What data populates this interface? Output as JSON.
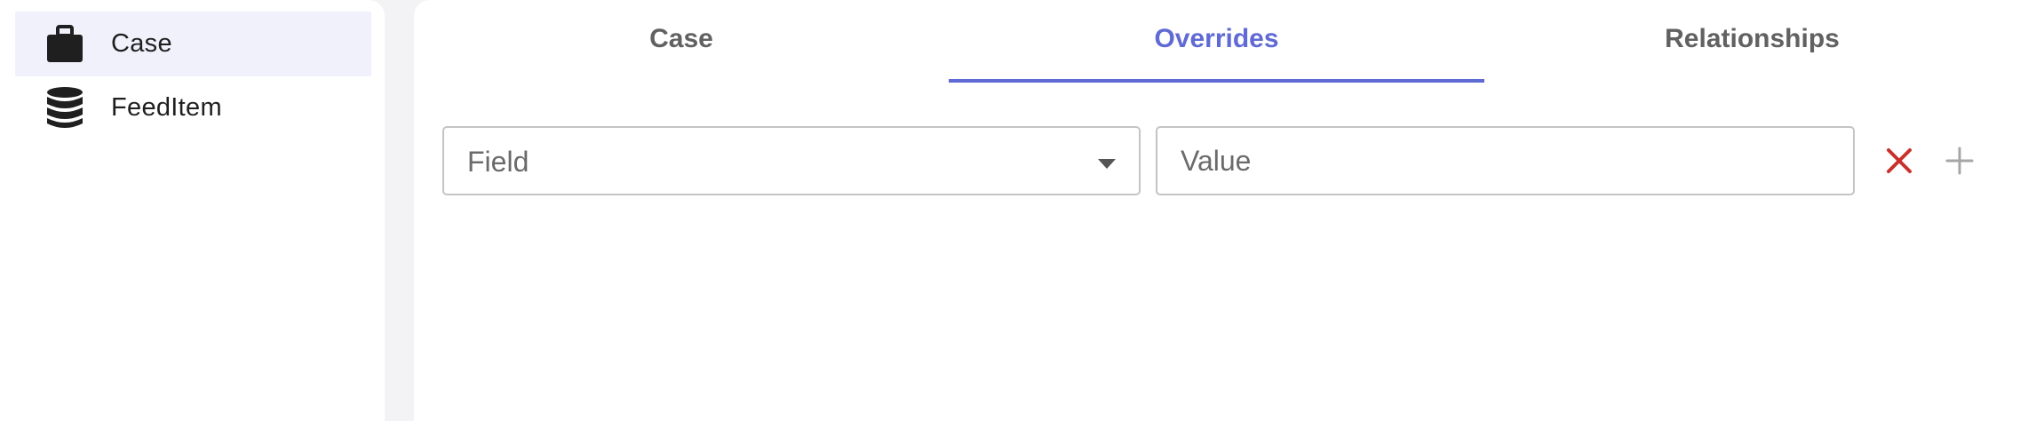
{
  "sidebar": {
    "items": [
      {
        "label": "Case",
        "icon": "briefcase-icon",
        "selected": true
      },
      {
        "label": "FeedItem",
        "icon": "database-icon",
        "selected": false
      }
    ]
  },
  "tabs": [
    {
      "label": "Case",
      "active": false
    },
    {
      "label": "Overrides",
      "active": true
    },
    {
      "label": "Relationships",
      "active": false
    }
  ],
  "overrides": {
    "field_placeholder": "Field",
    "value_placeholder": "Value",
    "remove_icon": "close-icon",
    "add_icon": "plus-icon"
  },
  "colors": {
    "accent": "#5f6ad4",
    "remove": "#c9302c",
    "add": "#a6a6a6",
    "selected_bg": "#f0f1fb"
  }
}
